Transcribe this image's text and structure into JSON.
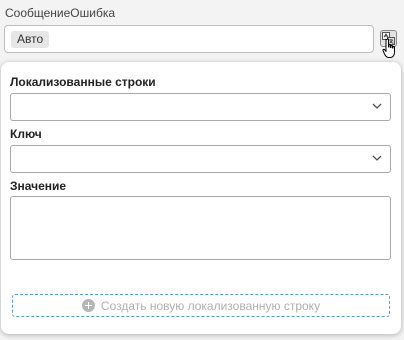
{
  "field": {
    "title": "СообщениеОшибка",
    "value_chip": "Авто"
  },
  "localization_popup": {
    "localized_strings_label": "Локализованные строки",
    "localized_strings_value": "",
    "key_label": "Ключ",
    "key_value": "",
    "value_label": "Значение",
    "value_text": "",
    "create_button_label": "Создать новую локализованную строку"
  },
  "icons": {
    "localize_button": "localize-icon",
    "dropdown": "chevron-down-icon",
    "create": "plus-circle-icon",
    "cursor": "hand-cursor-icon"
  }
}
